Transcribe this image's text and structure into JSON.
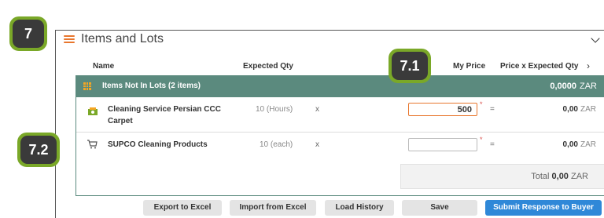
{
  "header": {
    "title": "Items and Lots"
  },
  "columns": {
    "name": "Name",
    "expected_qty": "Expected Qty",
    "my_price": "My Price",
    "price_x_qty": "Price x Expected Qty"
  },
  "group": {
    "label": "Items Not In Lots (2 items)",
    "total": "0,0000",
    "currency": "ZAR"
  },
  "rows": [
    {
      "name": "Cleaning Service Persian CCC Carpet",
      "qty": "10 (Hours)",
      "x": "x",
      "price": "500",
      "req": "*",
      "eq": "=",
      "total": "0,00",
      "currency": "ZAR"
    },
    {
      "name": "SUPCO Cleaning Products",
      "qty": "10 (each)",
      "x": "x",
      "price": "",
      "req": "*",
      "eq": "=",
      "total": "0,00",
      "currency": "ZAR"
    }
  ],
  "grand_total": {
    "label": "Total",
    "value": "0,00",
    "currency": "ZAR"
  },
  "buttons": {
    "export": "Export to Excel",
    "import": "Import from Excel",
    "load_history": "Load History",
    "save": "Save",
    "submit": "Submit Response to Buyer"
  },
  "badges": {
    "b7": "7",
    "b71": "7.1",
    "b72": "7.2"
  },
  "colors": {
    "group_bg": "#5b8a7e",
    "accent": "#e8762d",
    "primary": "#2f88d8",
    "badge_ring": "#7aa828",
    "badge_fill": "#3a3a3a"
  }
}
